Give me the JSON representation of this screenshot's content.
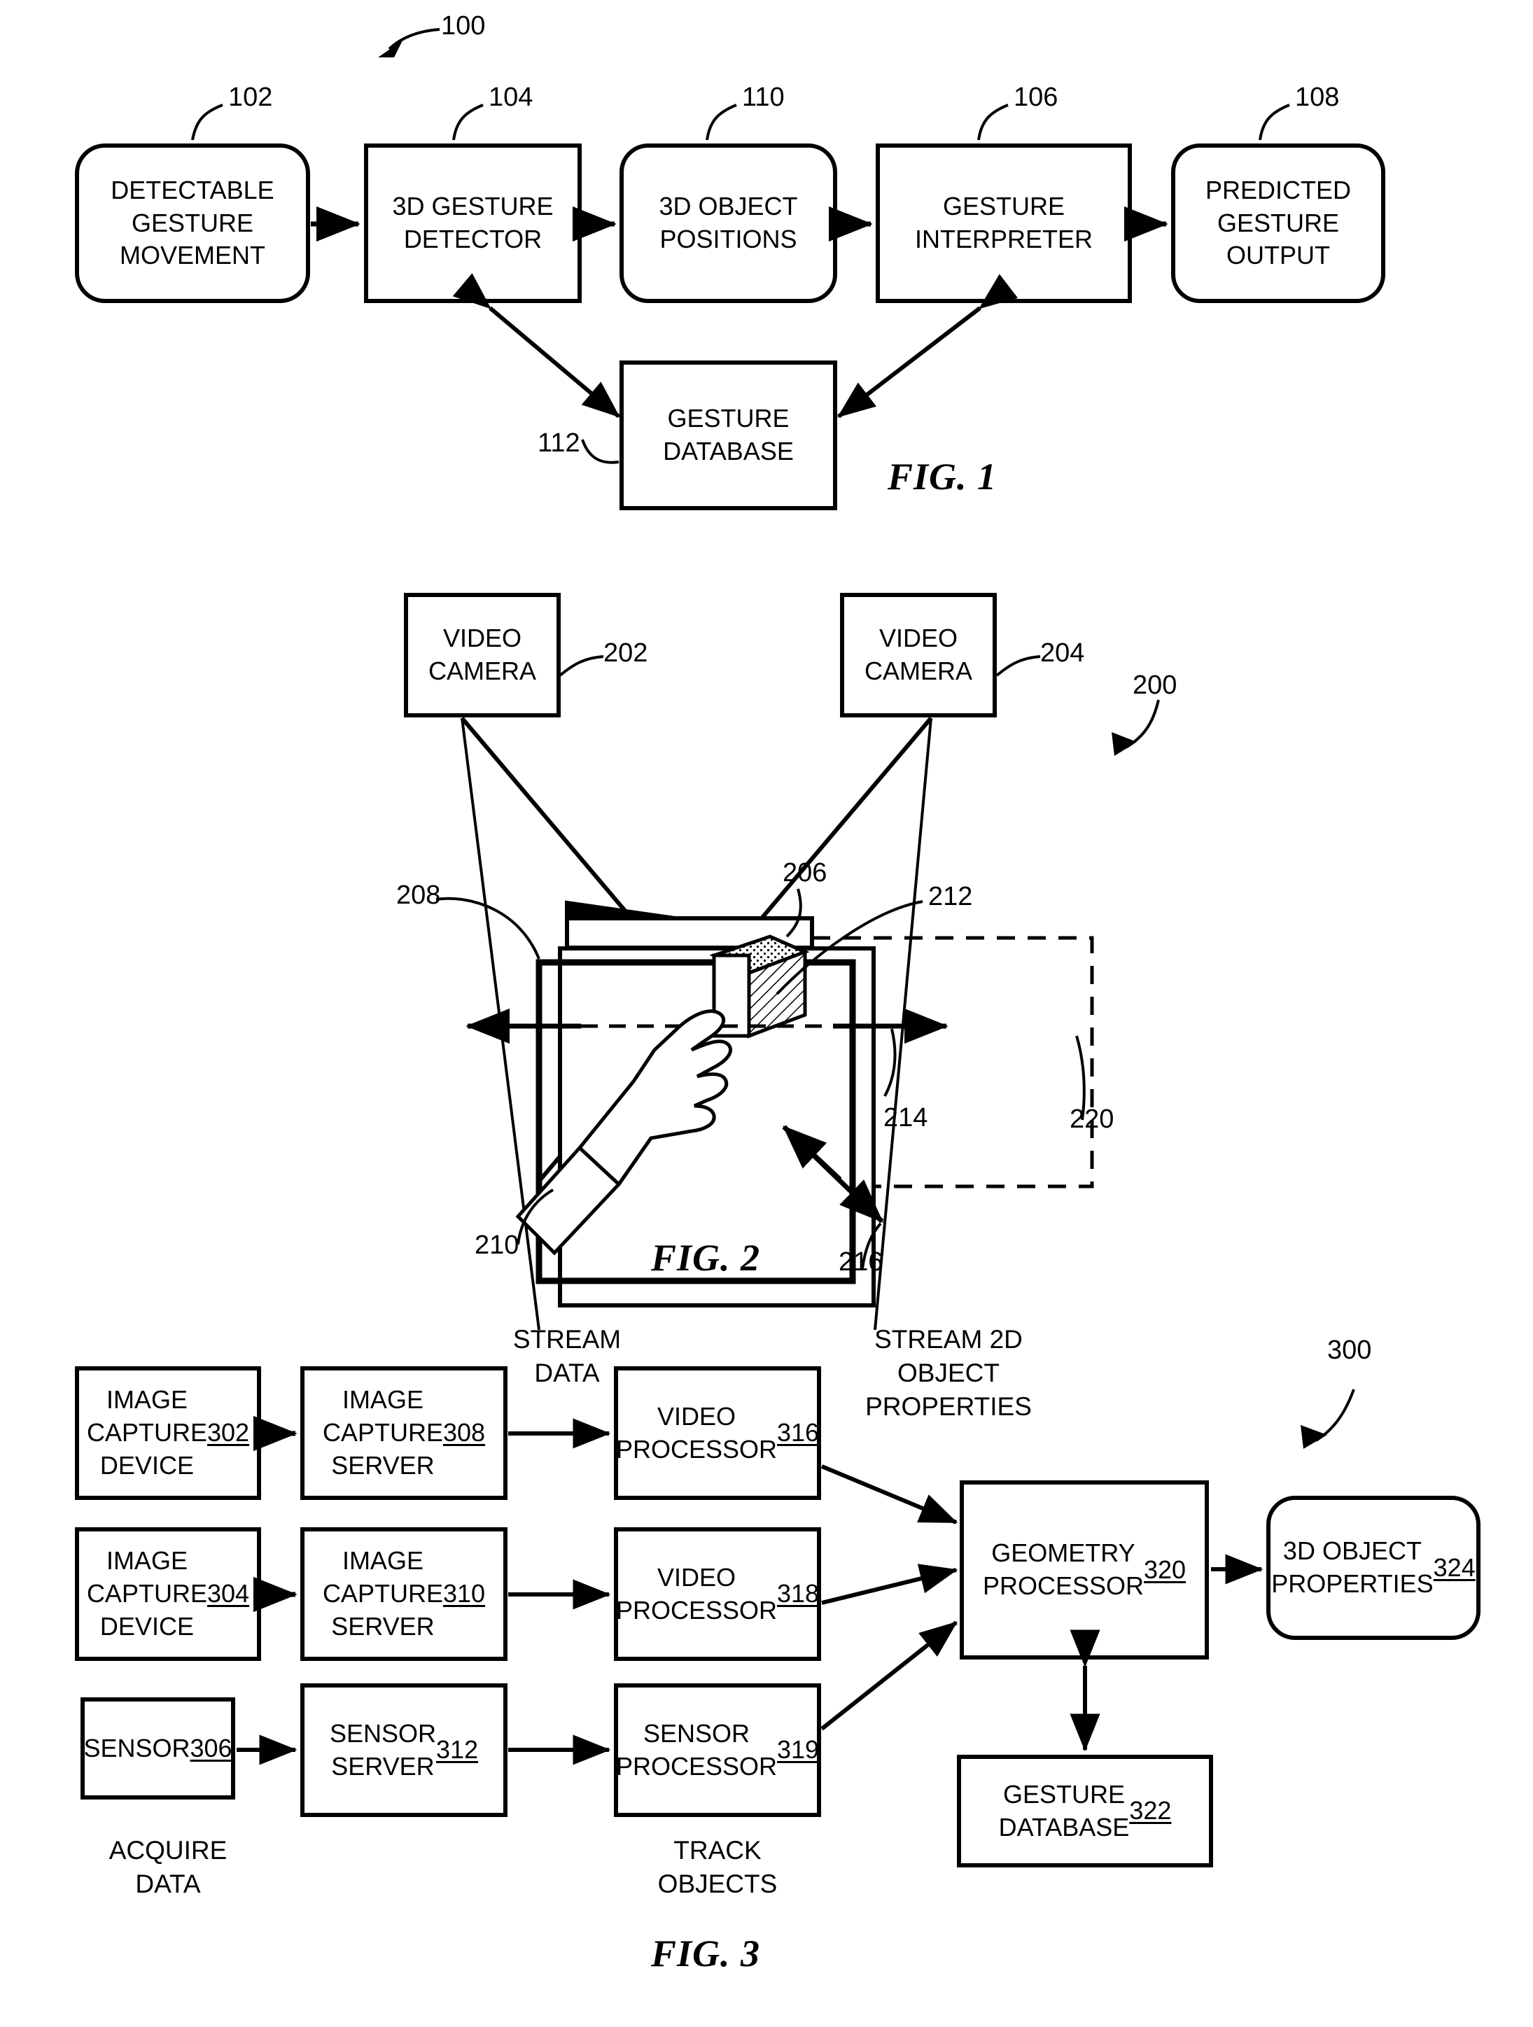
{
  "figures": [
    {
      "id": "fig1",
      "caption": "FIG. 1",
      "ref": "100",
      "blocks": [
        {
          "key": "f1_102",
          "label": "DETECTABLE\nGESTURE\nMOVEMENT",
          "ref": "102",
          "shape": "rounded"
        },
        {
          "key": "f1_104",
          "label": "3D GESTURE\nDETECTOR",
          "ref": "104",
          "shape": "rect"
        },
        {
          "key": "f1_110",
          "label": "3D OBJECT\nPOSITIONS",
          "ref": "110",
          "shape": "rounded"
        },
        {
          "key": "f1_106",
          "label": "GESTURE\nINTERPRETER",
          "ref": "106",
          "shape": "rect"
        },
        {
          "key": "f1_108",
          "label": "PREDICTED\nGESTURE\nOUTPUT",
          "ref": "108",
          "shape": "rounded"
        },
        {
          "key": "f1_112",
          "label": "GESTURE\nDATABASE",
          "ref": "112",
          "shape": "rect"
        }
      ]
    },
    {
      "id": "fig2",
      "caption": "FIG. 2",
      "ref": "200",
      "blocks": [
        {
          "key": "f2_202",
          "label": "VIDEO\nCAMERA",
          "ref": "202",
          "shape": "rect"
        },
        {
          "key": "f2_204",
          "label": "VIDEO\nCAMERA",
          "ref": "204",
          "shape": "rect"
        }
      ],
      "callouts": [
        {
          "key": "f2_206",
          "ref": "206"
        },
        {
          "key": "f2_208",
          "ref": "208"
        },
        {
          "key": "f2_210",
          "ref": "210"
        },
        {
          "key": "f2_212",
          "ref": "212"
        },
        {
          "key": "f2_214",
          "ref": "214"
        },
        {
          "key": "f2_216",
          "ref": "216"
        },
        {
          "key": "f2_220",
          "ref": "220"
        }
      ]
    },
    {
      "id": "fig3",
      "caption": "FIG. 3",
      "ref": "300",
      "blocks": [
        {
          "key": "f3_302",
          "label": "IMAGE\nCAPTURE\nDEVICE ",
          "ref": "302",
          "shape": "rect"
        },
        {
          "key": "f3_308",
          "label": "IMAGE\nCAPTURE\nSERVER ",
          "ref": "308",
          "shape": "rect"
        },
        {
          "key": "f3_316",
          "label": "VIDEO\nPROCESSOR\n",
          "ref": "316",
          "shape": "rect"
        },
        {
          "key": "f3_304",
          "label": "IMAGE\nCAPTURE\nDEVICE ",
          "ref": "304",
          "shape": "rect"
        },
        {
          "key": "f3_310",
          "label": "IMAGE\nCAPTURE\nSERVER ",
          "ref": "310",
          "shape": "rect"
        },
        {
          "key": "f3_318",
          "label": "VIDEO\nPROCESSOR\n",
          "ref": "318",
          "shape": "rect"
        },
        {
          "key": "f3_306",
          "label": "SENSOR\n",
          "ref": "306",
          "shape": "rect"
        },
        {
          "key": "f3_312",
          "label": "SENSOR\nSERVER\n",
          "ref": "312",
          "shape": "rect"
        },
        {
          "key": "f3_319",
          "label": "SENSOR\nPROCESSOR\n",
          "ref": "319",
          "shape": "rect"
        },
        {
          "key": "f3_320",
          "label": "GEOMETRY\nPROCESSOR\n",
          "ref": "320",
          "shape": "rect"
        },
        {
          "key": "f3_324",
          "label": "3D OBJECT\nPROPERTIES\n",
          "ref": "324",
          "shape": "rounded"
        },
        {
          "key": "f3_322",
          "label": "GESTURE\nDATABASE ",
          "ref": "322",
          "shape": "rect"
        }
      ],
      "flow_labels": [
        {
          "key": "f3_stream_data",
          "text": "STREAM\nDATA"
        },
        {
          "key": "f3_stream_2d",
          "text": "STREAM 2D\nOBJECT\nPROPERTIES"
        },
        {
          "key": "f3_acquire",
          "text": "ACQUIRE\nDATA"
        },
        {
          "key": "f3_track",
          "text": "TRACK\nOBJECTS"
        }
      ]
    }
  ],
  "colors": {
    "ink": "#000000",
    "paper": "#ffffff"
  }
}
